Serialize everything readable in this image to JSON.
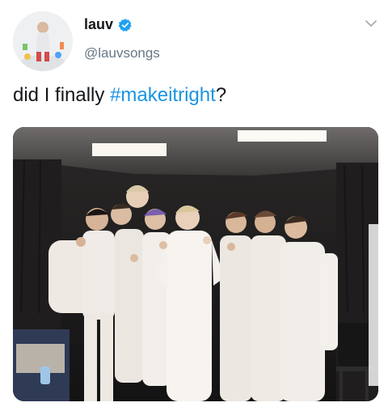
{
  "tweet": {
    "display_name": "lauv",
    "handle": "@lauvsongs",
    "text_prefix": "did I finally ",
    "hashtag": "#makeitright",
    "text_suffix": "?",
    "verified": true
  },
  "icons": {
    "verified": "verified-badge-icon",
    "menu": "chevron-down-icon"
  },
  "colors": {
    "accent": "#1b95e0",
    "verified": "#1da1f2",
    "handle": "#657786",
    "text": "#14171a"
  }
}
